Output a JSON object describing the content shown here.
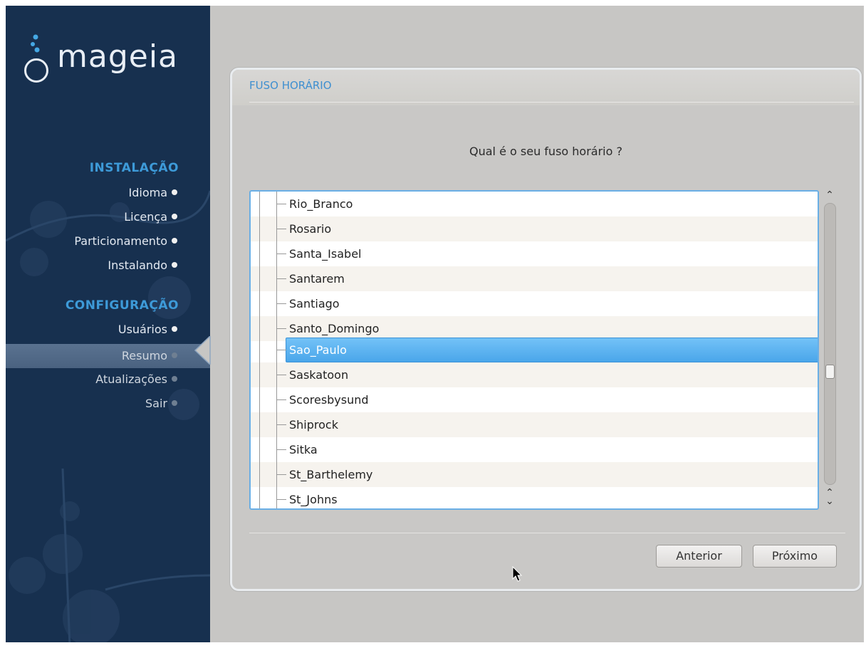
{
  "sidebar": {
    "logo_text": "mageia",
    "sections": [
      {
        "title": "INSTALAÇÃO"
      },
      {
        "title": "CONFIGURAÇÃO"
      }
    ],
    "install_steps": [
      {
        "label": "Idioma",
        "state": "done"
      },
      {
        "label": "Licença",
        "state": "done"
      },
      {
        "label": "Particionamento",
        "state": "done"
      },
      {
        "label": "Instalando",
        "state": "done"
      }
    ],
    "config_steps": [
      {
        "label": "Usuários",
        "state": "done"
      },
      {
        "label": "Resumo",
        "state": "active"
      },
      {
        "label": "Atualizações",
        "state": "pending"
      },
      {
        "label": "Sair",
        "state": "pending"
      }
    ]
  },
  "window": {
    "title": "FUSO HORÁRIO",
    "question": "Qual é o seu fuso horário ?",
    "timezones": [
      "Rio_Branco",
      "Rosario",
      "Santa_Isabel",
      "Santarem",
      "Santiago",
      "Santo_Domingo",
      "Sao_Paulo",
      "Saskatoon",
      "Scoresbysund",
      "Shiprock",
      "Sitka",
      "St_Barthelemy",
      "St_Johns"
    ],
    "selected_timezone": "Sao_Paulo",
    "buttons": {
      "previous": "Anterior",
      "next": "Próximo"
    }
  },
  "colors": {
    "sidebar_bg": "#17304f",
    "accent": "#3d9ad8",
    "selection": "#4aa6ea",
    "window_bg": "#c9c8c6"
  }
}
